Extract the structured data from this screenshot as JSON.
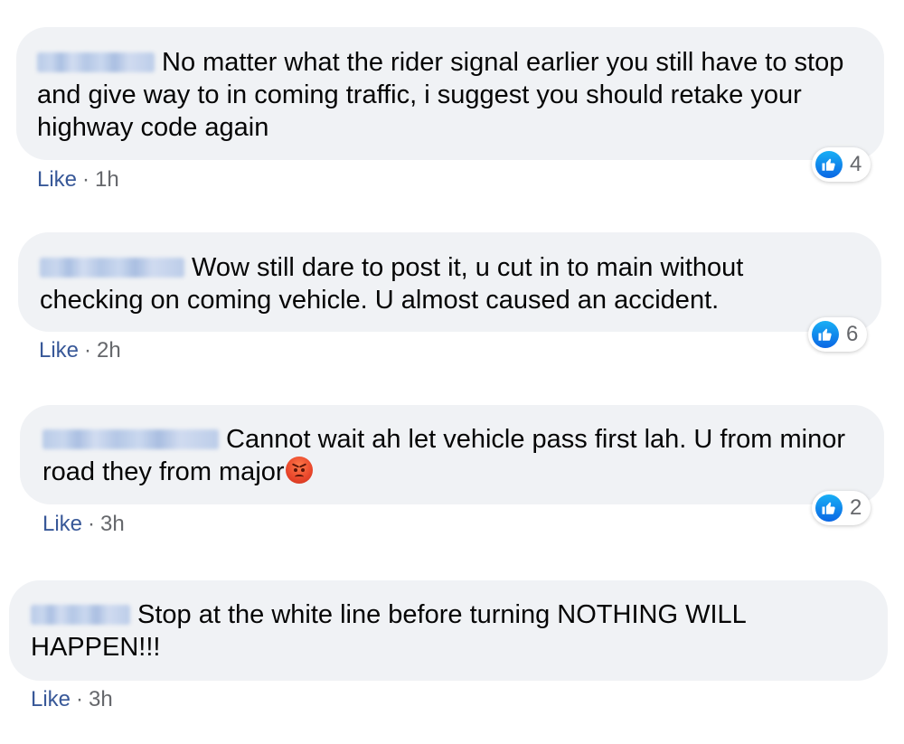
{
  "comments": [
    {
      "text": "No matter what the rider signal earlier you still have to stop and give way to in coming traffic, i suggest you should retake your highway code again",
      "like_label": "Like",
      "separator": "·",
      "time": "1h",
      "reaction_count": "4"
    },
    {
      "text": "Wow still dare to post it, u cut in to main without checking on coming vehicle. U almost caused an accident.",
      "like_label": "Like",
      "separator": "·",
      "time": "2h",
      "reaction_count": "6"
    },
    {
      "text": "Cannot wait ah let vehicle pass first lah. U from minor road they from major",
      "emoji": "angry-face",
      "like_label": "Like",
      "separator": "·",
      "time": "3h",
      "reaction_count": "2"
    },
    {
      "text": "Stop at the white line before turning NOTHING WILL HAPPEN!!!",
      "like_label": "Like",
      "separator": "·",
      "time": "3h"
    }
  ],
  "colors": {
    "bubble_bg": "#f0f2f5",
    "like_link": "#385898",
    "meta_text": "#65676b",
    "like_icon": "#1877f2"
  }
}
